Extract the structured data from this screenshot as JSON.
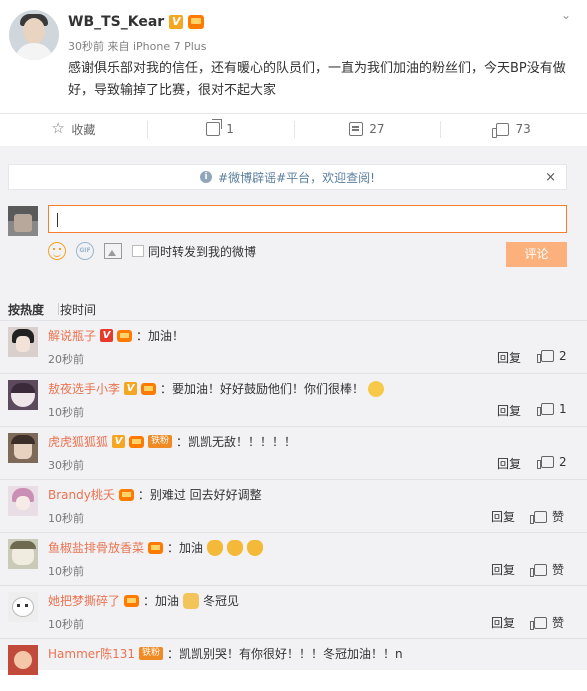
{
  "post": {
    "username": "WB_TS_Kear",
    "meta": "30秒前 来自 iPhone 7 Plus",
    "text": "感谢俱乐部对我的信任，还有暖心的队员们，一直为我们加油的粉丝们，今天BP没有做好，导致输掉了比赛，很对不起大家",
    "badge_v": "V",
    "menu_icon": "chevron-down-icon"
  },
  "actions": {
    "favorite_label": "收藏",
    "repost_count": "1",
    "comment_count": "27",
    "like_count": "73"
  },
  "comments_panel": {
    "notice": "#微博辟谣#平台，欢迎查阅!",
    "notice_close": "×",
    "input_value": "",
    "also_repost_label": "同时转发到我的微博",
    "submit_label": "评论",
    "sort_hot": "按热度",
    "sort_time": "按时间"
  },
  "comments": [
    {
      "name": "解说瓶子",
      "text": "：加油！",
      "time": "20秒前",
      "reply": "回复",
      "like": "2",
      "has_v": true,
      "v_color": "red",
      "has_tiefen": false,
      "emoji": ""
    },
    {
      "name": "敖夜选手小李",
      "text": "：要加油！好好鼓励他们！你们很棒！",
      "time": "10秒前",
      "reply": "回复",
      "like": "1",
      "has_v": true,
      "v_color": "orange",
      "has_tiefen": false,
      "emoji": "hug"
    },
    {
      "name": "虎虎狐狐狐",
      "text": "：凯凯无敌！！！！！",
      "time": "30秒前",
      "reply": "回复",
      "like": "2",
      "has_v": true,
      "v_color": "orange",
      "has_tiefen": true,
      "emoji": ""
    },
    {
      "name": "Brandy桃夭",
      "text": "：别难过 回去好好调整",
      "time": "10秒前",
      "reply": "回复",
      "like": "赞",
      "has_v": false,
      "v_color": "",
      "has_tiefen": false,
      "emoji": ""
    },
    {
      "name": "鱼椒盐排骨放香菜",
      "text": "：加油",
      "time": "10秒前",
      "reply": "回复",
      "like": "赞",
      "has_v": false,
      "v_color": "",
      "has_tiefen": false,
      "emoji": "cheer"
    },
    {
      "name": "她把梦撕碎了",
      "text": "：加油",
      "text2": "冬冠见",
      "time": "10秒前",
      "reply": "回复",
      "like": "赞",
      "has_v": false,
      "v_color": "",
      "has_tiefen": false,
      "emoji": "fist"
    },
    {
      "name": "Hammer陈131",
      "text": "：凯凯别哭！有你很好！！！冬冠加油！！n",
      "time": "",
      "reply": "",
      "like": "",
      "has_v": false,
      "v_color": "",
      "has_tiefen": true,
      "emoji": ""
    }
  ],
  "tiefen_label": "铁粉"
}
